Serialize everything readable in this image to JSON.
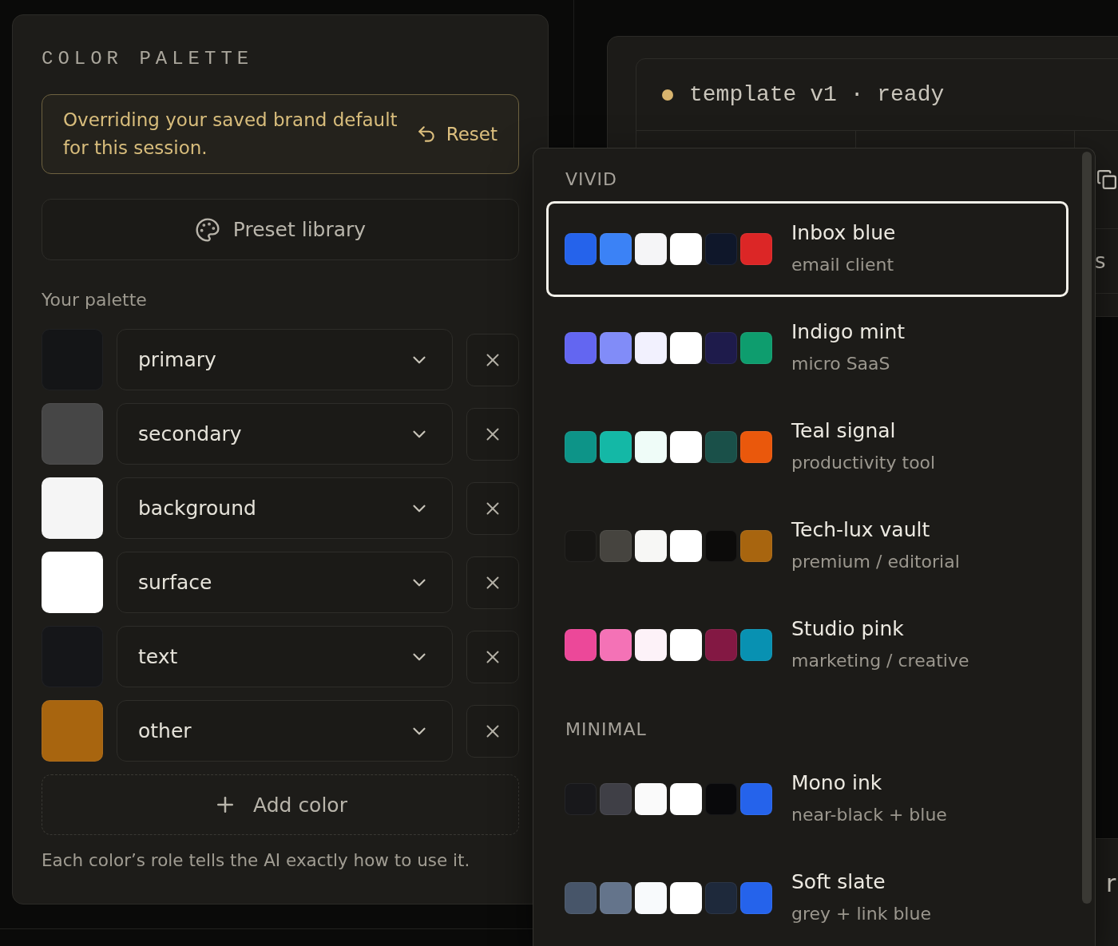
{
  "palette_panel": {
    "title": "COLOR PALETTE",
    "notice": {
      "text": "Overriding your saved brand default for this session.",
      "action": "Reset"
    },
    "preset_button": "Preset library",
    "section_label": "Your palette",
    "colors": [
      {
        "role": "primary",
        "color": "#141517"
      },
      {
        "role": "secondary",
        "color": "#464646"
      },
      {
        "role": "background",
        "color": "#f5f5f5"
      },
      {
        "role": "surface",
        "color": "#ffffff"
      },
      {
        "role": "text",
        "color": "#151619"
      },
      {
        "role": "other",
        "color": "#a8650f"
      }
    ],
    "add_button": "Add color",
    "hint": "Each color’s role tells the AI exactly how to use it."
  },
  "preview_window": {
    "status_label": "template v1 · ready",
    "partial_label": "s"
  },
  "lower_panel": {
    "partial_label": "r"
  },
  "preset_menu": {
    "sections": [
      {
        "title": "VIVID",
        "presets": [
          {
            "name": "Inbox blue",
            "description": "email client",
            "selected": true,
            "swatches": [
              {
                "color": "#2563eb"
              },
              {
                "color": "#3b82f6"
              },
              {
                "color": "#f5f5f7"
              },
              {
                "color": "#ffffff"
              },
              {
                "color": "#0f172a"
              },
              {
                "color": "#dc2626"
              }
            ]
          },
          {
            "name": "Indigo mint",
            "description": "micro SaaS",
            "selected": false,
            "swatches": [
              {
                "color": "#6366f1"
              },
              {
                "color": "#818cf8"
              },
              {
                "color": "#f2f1fe"
              },
              {
                "color": "#ffffff"
              },
              {
                "color": "#1e1b4b"
              },
              {
                "color": "#0e9d6e"
              }
            ]
          },
          {
            "name": "Teal signal",
            "description": "productivity tool",
            "selected": false,
            "swatches": [
              {
                "color": "#0d9488"
              },
              {
                "color": "#14b8a6"
              },
              {
                "color": "#effcf8"
              },
              {
                "color": "#ffffff"
              },
              {
                "color": "#1a5049"
              },
              {
                "color": "#ea580c"
              }
            ]
          },
          {
            "name": "Tech-lux vault",
            "description": "premium / editorial",
            "selected": false,
            "swatches": [
              {
                "color": "#171614"
              },
              {
                "color": "#46443f"
              },
              {
                "color": "#f7f7f5"
              },
              {
                "color": "#ffffff"
              },
              {
                "color": "#0c0b0a"
              },
              {
                "color": "#a8650f"
              }
            ]
          },
          {
            "name": "Studio pink",
            "description": "marketing / creative",
            "selected": false,
            "swatches": [
              {
                "color": "#ec4899"
              },
              {
                "color": "#f472b6"
              },
              {
                "color": "#fdf2f8"
              },
              {
                "color": "#ffffff"
              },
              {
                "color": "#831843"
              },
              {
                "color": "#0891b2"
              }
            ]
          }
        ]
      },
      {
        "title": "MINIMAL",
        "presets": [
          {
            "name": "Mono ink",
            "description": "near-black + blue",
            "selected": false,
            "swatches": [
              {
                "color": "#18181b"
              },
              {
                "color": "#3f3f46"
              },
              {
                "color": "#fafafa"
              },
              {
                "color": "#ffffff"
              },
              {
                "color": "#09090b"
              },
              {
                "color": "#2563eb"
              }
            ]
          },
          {
            "name": "Soft slate",
            "description": "grey + link blue",
            "selected": false,
            "swatches": [
              {
                "color": "#475569"
              },
              {
                "color": "#64748b"
              },
              {
                "color": "#f8fafc"
              },
              {
                "color": "#ffffff"
              },
              {
                "color": "#1e293b"
              },
              {
                "color": "#2563eb"
              }
            ]
          }
        ]
      }
    ]
  }
}
